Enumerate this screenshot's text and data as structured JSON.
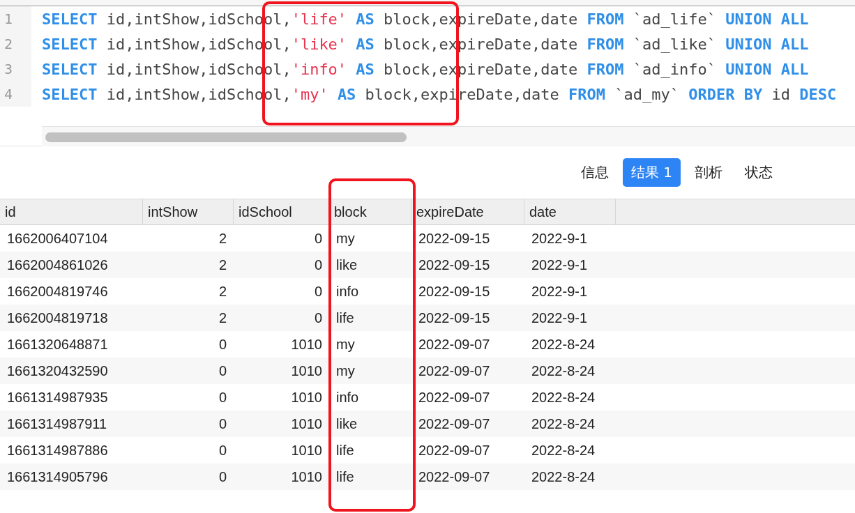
{
  "editor": {
    "lines": [
      {
        "number": "1",
        "tokens": [
          {
            "kind": "keyword",
            "text": "SELECT"
          },
          {
            "kind": "plain",
            "text": " id,intShow,idSchool,"
          },
          {
            "kind": "string",
            "text": "'life' "
          },
          {
            "kind": "keyword",
            "text": "AS"
          },
          {
            "kind": "plain",
            "text": " block,expireDate,date "
          },
          {
            "kind": "keyword",
            "text": "FROM"
          },
          {
            "kind": "plain",
            "text": " `ad_life` "
          },
          {
            "kind": "keyword",
            "text": "UNION ALL"
          }
        ]
      },
      {
        "number": "2",
        "tokens": [
          {
            "kind": "keyword",
            "text": "SELECT"
          },
          {
            "kind": "plain",
            "text": " id,intShow,idSchool,"
          },
          {
            "kind": "string",
            "text": "'like' "
          },
          {
            "kind": "keyword",
            "text": "AS"
          },
          {
            "kind": "plain",
            "text": " block,expireDate,date "
          },
          {
            "kind": "keyword",
            "text": "FROM"
          },
          {
            "kind": "plain",
            "text": " `ad_like` "
          },
          {
            "kind": "keyword",
            "text": "UNION ALL"
          }
        ]
      },
      {
        "number": "3",
        "tokens": [
          {
            "kind": "keyword",
            "text": "SELECT"
          },
          {
            "kind": "plain",
            "text": " id,intShow,idSchool,"
          },
          {
            "kind": "string",
            "text": "'info' "
          },
          {
            "kind": "keyword",
            "text": "AS"
          },
          {
            "kind": "plain",
            "text": " block,expireDate,date "
          },
          {
            "kind": "keyword",
            "text": "FROM"
          },
          {
            "kind": "plain",
            "text": " `ad_info` "
          },
          {
            "kind": "keyword",
            "text": "UNION ALL"
          }
        ]
      },
      {
        "number": "4",
        "tokens": [
          {
            "kind": "keyword",
            "text": "SELECT"
          },
          {
            "kind": "plain",
            "text": " id,intShow,idSchool,"
          },
          {
            "kind": "string",
            "text": "'my' "
          },
          {
            "kind": "keyword",
            "text": "AS"
          },
          {
            "kind": "plain",
            "text": " block,expireDate,date "
          },
          {
            "kind": "keyword",
            "text": "FROM"
          },
          {
            "kind": "plain",
            "text": " `ad_my` "
          },
          {
            "kind": "keyword",
            "text": "ORDER BY"
          },
          {
            "kind": "plain",
            "text": " id "
          },
          {
            "kind": "keyword",
            "text": "DESC"
          }
        ]
      }
    ]
  },
  "result_tabs": [
    {
      "label": "信息",
      "selected": false
    },
    {
      "label": "结果 1",
      "selected": true
    },
    {
      "label": "剖析",
      "selected": false
    },
    {
      "label": "状态",
      "selected": false
    }
  ],
  "table": {
    "columns": [
      "id",
      "intShow",
      "idSchool",
      "block",
      "expireDate",
      "date"
    ],
    "rows": [
      [
        "1662006407104",
        "2",
        "0",
        "my",
        "2022-09-15",
        "2022-9-1"
      ],
      [
        "1662004861026",
        "2",
        "0",
        "like",
        "2022-09-15",
        "2022-9-1"
      ],
      [
        "1662004819746",
        "2",
        "0",
        "info",
        "2022-09-15",
        "2022-9-1"
      ],
      [
        "1662004819718",
        "2",
        "0",
        "life",
        "2022-09-15",
        "2022-9-1"
      ],
      [
        "1661320648871",
        "0",
        "1010",
        "my",
        "2022-09-07",
        "2022-8-24"
      ],
      [
        "1661320432590",
        "0",
        "1010",
        "my",
        "2022-09-07",
        "2022-8-24"
      ],
      [
        "1661314987935",
        "0",
        "1010",
        "info",
        "2022-09-07",
        "2022-8-24"
      ],
      [
        "1661314987911",
        "0",
        "1010",
        "like",
        "2022-09-07",
        "2022-8-24"
      ],
      [
        "1661314987886",
        "0",
        "1010",
        "life",
        "2022-09-07",
        "2022-8-24"
      ],
      [
        "1661314905796",
        "0",
        "1010",
        "life",
        "2022-09-07",
        "2022-8-24"
      ]
    ]
  }
}
